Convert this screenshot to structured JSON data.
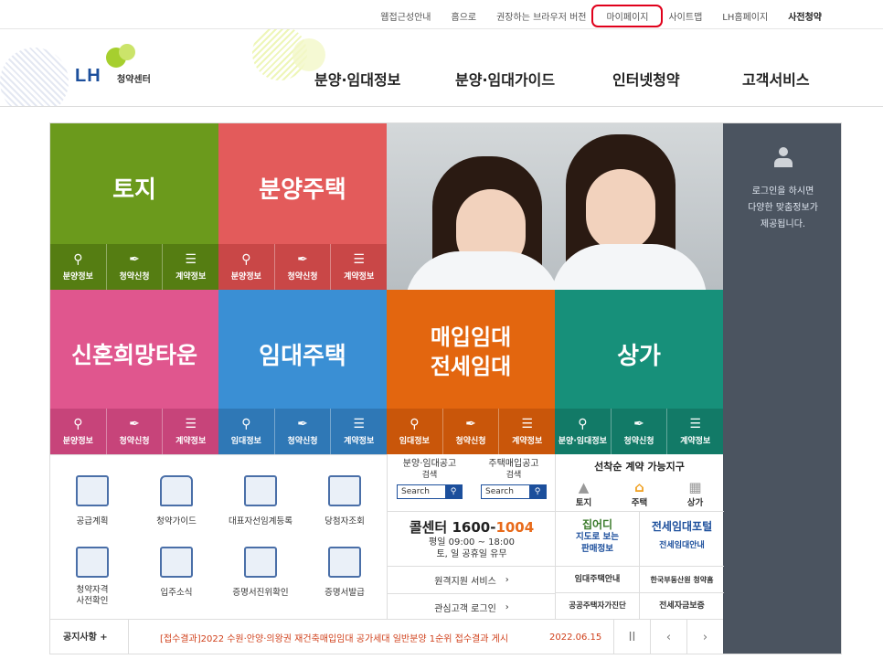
{
  "topbar": {
    "links": [
      "웹접근성안내",
      "홈으로",
      "권장하는 브라우저 버전",
      "마이페이지",
      "사이트맵",
      "LH홈페이지",
      "사전청약"
    ]
  },
  "logo": {
    "brand": "LH",
    "center": "청약센터"
  },
  "gnb": {
    "items": [
      "분양·임대정보",
      "분양·임대가이드",
      "인터넷청약",
      "고객서비스"
    ]
  },
  "tiles": [
    {
      "title": "토지",
      "subs": [
        "분양정보",
        "청약신청",
        "계약정보"
      ]
    },
    {
      "title": "분양주택",
      "subs": [
        "분양정보",
        "청약신청",
        "계약정보"
      ]
    },
    {
      "title": "신혼희망타운",
      "subs": [
        "분양정보",
        "청약신청",
        "계약정보"
      ]
    },
    {
      "title": "임대주택",
      "subs": [
        "임대정보",
        "청약신청",
        "계약정보"
      ]
    },
    {
      "title_line1": "매입임대",
      "title_line2": "전세임대",
      "subs": [
        "임대정보",
        "청약신청",
        "계약정보"
      ]
    },
    {
      "title": "상가",
      "subs": [
        "분양·임대정보",
        "청약신청",
        "계약정보"
      ]
    }
  ],
  "side": {
    "line1": "로그인을 하시면",
    "line2": "다양한 맞춤정보가",
    "line3": "제공됩니다."
  },
  "services": [
    "공급계획",
    "청약가이드",
    "대표자선임계등록",
    "당첨자조회",
    "청약자격\n사전확인",
    "입주소식",
    "증명서진위확인",
    "증명서발급"
  ],
  "search": [
    {
      "l1": "분양·임대공고",
      "l2": "검색",
      "btn": "Search"
    },
    {
      "l1": "주택매입공고",
      "l2": "검색",
      "btn": "Search"
    }
  ],
  "call": {
    "label": "콜센터",
    "num1": "1600-",
    "num2": "1004",
    "hours": "평일 09:00 ~ 18:00",
    "closed": "토, 일 공휴일 유무"
  },
  "links": {
    "remote": "원격지원 서비스",
    "login": "관심고객 로그인"
  },
  "first_come": {
    "title": "선착순 계약 가능지구",
    "items": [
      "토지",
      "주택",
      "상가"
    ]
  },
  "banners": {
    "jibeodi1": "집어디",
    "jibeodi2": "지도로 보는",
    "jibeodi3": "판매정보",
    "jeonse1": "전세임대포털",
    "jeonse2": "전세임대안내",
    "rental": "임대주택안내",
    "kab": "한국부동산원 청약홈",
    "public": "공공주택자가진단",
    "hf": "전세자금보증"
  },
  "notice": {
    "label": "공지사항",
    "plus": "+",
    "text": "[접수결과]2022 수원·안양·의왕권 재건축매입임대 공가세대 일반분양 1순위 접수결과 게시",
    "date": "2022.06.15",
    "pause": "II",
    "prev": "‹",
    "next": "›"
  },
  "colors": {
    "land": "#6b9a1c",
    "sale": "#e35b5b",
    "newlywed": "#e0568e",
    "rent": "#3a8fd4",
    "purchase": "#e3660f",
    "store": "#17907a",
    "side": "#4b5460"
  }
}
